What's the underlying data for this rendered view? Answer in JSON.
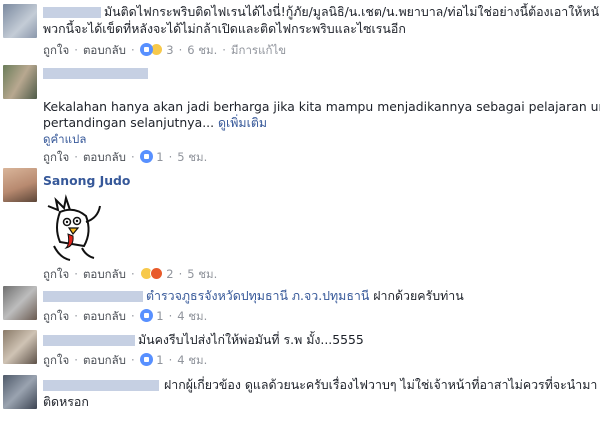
{
  "colors": {
    "link": "#365899",
    "text": "#1d2129",
    "meta": "#90949c",
    "like": "#5890ff"
  },
  "comments": [
    {
      "name": "",
      "text_lines": [
        "มันติดไฟกระพริบติดไฟเรนได้ไงนี่!กู้ภัย/มูลนิธิ/น.เชต/น.พยาบาล/ท่อไม่ใช่อย่างนี้ต้องเอาให้หนัก",
        "พวกนี้จะได้เข็ดที่หลังจะได้ไม่กล้าเปิดและติดไฟกระพริบและไซเรนอีก"
      ],
      "like": "ถูกใจ",
      "reply": "ตอบกลับ",
      "reactions": [
        "like-icon",
        "haha-icon"
      ],
      "count": "3",
      "time": "6 ชม.",
      "edited": "มีการแก้ไข"
    },
    {
      "name": "",
      "text_lines": [
        "Kekalahan hanya akan jadi berharga jika kita mampu menjadikannya sebagai pelajaran untuk",
        "pertandingan selanjutnya..."
      ],
      "see_more": "ดูเพิ่มเติม",
      "translate": "ดูคำแปล",
      "like": "ถูกใจ",
      "reply": "ตอบกลับ",
      "reactions": [
        "like-icon"
      ],
      "count": "1",
      "time": "5 ชม."
    },
    {
      "name": "Sanong Judo",
      "sticker": "chicken-sticker",
      "like": "ถูกใจ",
      "reply": "ตอบกลับ",
      "reactions": [
        "haha-icon",
        "angry-icon"
      ],
      "count": "2",
      "time": "5 ชม."
    },
    {
      "name": "ตำรวจภูธรจังหวัดปทุมธานี ภ.จว.ปทุมธานี",
      "text": "ฝากด้วยครับท่าน",
      "like": "ถูกใจ",
      "reply": "ตอบกลับ",
      "reactions": [
        "like-icon"
      ],
      "count": "1",
      "time": "4 ชม."
    },
    {
      "name": "",
      "text": "มันคงรีบไปส่งไก่ให้พ่อมันที่ ร.พ มั้ง...5555",
      "like": "ถูกใจ",
      "reply": "ตอบกลับ",
      "reactions": [
        "like-icon"
      ],
      "count": "1",
      "time": "4 ชม."
    },
    {
      "name": "",
      "text_lines": [
        "ฝากผู้เกี่ยวข้อง ดูแลด้วยนะครับเรื่องไฟวาบๆ ไม่ใช่เจ้าหน้าที่อาสาไม่ควรที่จะนำมา",
        "ติดหรอก"
      ]
    }
  ]
}
